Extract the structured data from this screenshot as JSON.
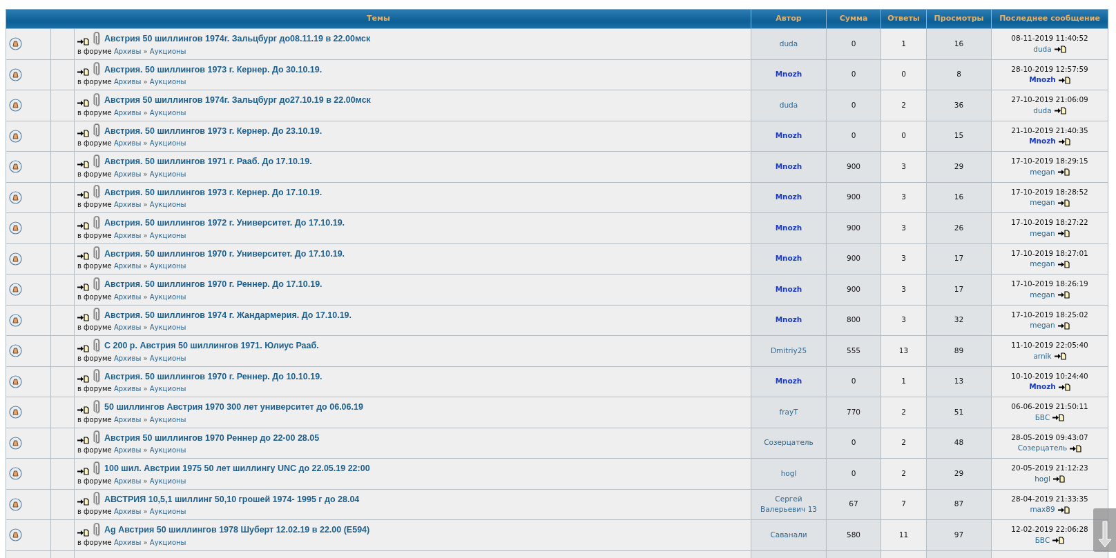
{
  "columns": [
    "Темы",
    "Автор",
    "Сумма",
    "Ответы",
    "Просмотры",
    "Последнее сообщение"
  ],
  "topics": [
    {
      "title": "Австрия 50 шиллингов 1974г. Зальцбург до08.11.19 в 22.00мск",
      "forum_prefix": "в форуме",
      "forum": "Архивы",
      "separator": "»",
      "subforum": "Аукционы",
      "author": {
        "name": "duda",
        "kind": "member"
      },
      "sum": "0",
      "replies": "1",
      "views": "16",
      "last_post": {
        "time": "08-11-2019 11:40:52",
        "author": {
          "name": "duda",
          "kind": "member"
        }
      }
    },
    {
      "title": "Австрия. 50 шиллингов 1973 г. Кернер. До 30.10.19.",
      "forum_prefix": "в форуме",
      "forum": "Архивы",
      "separator": "»",
      "subforum": "Аукционы",
      "author": {
        "name": "Mnozh",
        "kind": "staff"
      },
      "sum": "0",
      "replies": "0",
      "views": "8",
      "last_post": {
        "time": "28-10-2019 12:57:59",
        "author": {
          "name": "Mnozh",
          "kind": "staff"
        }
      }
    },
    {
      "title": "Австрия 50 шиллингов 1974г. Зальцбург до27.10.19 в 22.00мск",
      "forum_prefix": "в форуме",
      "forum": "Архивы",
      "separator": "»",
      "subforum": "Аукционы",
      "author": {
        "name": "duda",
        "kind": "member"
      },
      "sum": "0",
      "replies": "2",
      "views": "36",
      "last_post": {
        "time": "27-10-2019 21:06:09",
        "author": {
          "name": "duda",
          "kind": "member"
        }
      }
    },
    {
      "title": "Австрия. 50 шиллингов 1973 г. Кернер. До 23.10.19.",
      "forum_prefix": "в форуме",
      "forum": "Архивы",
      "separator": "»",
      "subforum": "Аукционы",
      "author": {
        "name": "Mnozh",
        "kind": "staff"
      },
      "sum": "0",
      "replies": "0",
      "views": "15",
      "last_post": {
        "time": "21-10-2019 21:40:35",
        "author": {
          "name": "Mnozh",
          "kind": "staff"
        }
      }
    },
    {
      "title": "Австрия. 50 шиллингов 1971 г. Рааб. До 17.10.19.",
      "forum_prefix": "в форуме",
      "forum": "Архивы",
      "separator": "»",
      "subforum": "Аукционы",
      "author": {
        "name": "Mnozh",
        "kind": "staff"
      },
      "sum": "900",
      "replies": "3",
      "views": "29",
      "last_post": {
        "time": "17-10-2019 18:29:15",
        "author": {
          "name": "megan",
          "kind": "member"
        }
      }
    },
    {
      "title": "Австрия. 50 шиллингов 1973 г. Кернер. До 17.10.19.",
      "forum_prefix": "в форуме",
      "forum": "Архивы",
      "separator": "»",
      "subforum": "Аукционы",
      "author": {
        "name": "Mnozh",
        "kind": "staff"
      },
      "sum": "900",
      "replies": "3",
      "views": "16",
      "last_post": {
        "time": "17-10-2019 18:28:52",
        "author": {
          "name": "megan",
          "kind": "member"
        }
      }
    },
    {
      "title": "Австрия. 50 шиллингов 1972 г. Университет. До 17.10.19.",
      "forum_prefix": "в форуме",
      "forum": "Архивы",
      "separator": "»",
      "subforum": "Аукционы",
      "author": {
        "name": "Mnozh",
        "kind": "staff"
      },
      "sum": "900",
      "replies": "3",
      "views": "26",
      "last_post": {
        "time": "17-10-2019 18:27:22",
        "author": {
          "name": "megan",
          "kind": "member"
        }
      }
    },
    {
      "title": "Австрия. 50 шиллингов 1970 г. Университет. До 17.10.19.",
      "forum_prefix": "в форуме",
      "forum": "Архивы",
      "separator": "»",
      "subforum": "Аукционы",
      "author": {
        "name": "Mnozh",
        "kind": "staff"
      },
      "sum": "900",
      "replies": "3",
      "views": "17",
      "last_post": {
        "time": "17-10-2019 18:27:01",
        "author": {
          "name": "megan",
          "kind": "member"
        }
      }
    },
    {
      "title": "Австрия. 50 шиллингов 1970 г. Реннер. До 17.10.19.",
      "forum_prefix": "в форуме",
      "forum": "Архивы",
      "separator": "»",
      "subforum": "Аукционы",
      "author": {
        "name": "Mnozh",
        "kind": "staff"
      },
      "sum": "900",
      "replies": "3",
      "views": "17",
      "last_post": {
        "time": "17-10-2019 18:26:19",
        "author": {
          "name": "megan",
          "kind": "member"
        }
      }
    },
    {
      "title": "Австрия. 50 шиллингов 1974 г. Жандармерия. До 17.10.19.",
      "forum_prefix": "в форуме",
      "forum": "Архивы",
      "separator": "»",
      "subforum": "Аукционы",
      "author": {
        "name": "Mnozh",
        "kind": "staff"
      },
      "sum": "800",
      "replies": "3",
      "views": "32",
      "last_post": {
        "time": "17-10-2019 18:25:02",
        "author": {
          "name": "megan",
          "kind": "member"
        }
      }
    },
    {
      "title": "С 200 р. Австрия 50 шиллингов 1971. Юлиус Рааб.",
      "forum_prefix": "в форуме",
      "forum": "Архивы",
      "separator": "»",
      "subforum": "Аукционы",
      "author": {
        "name": "Dmitriy25",
        "kind": "member"
      },
      "sum": "555",
      "replies": "13",
      "views": "89",
      "last_post": {
        "time": "11-10-2019 22:05:40",
        "author": {
          "name": "arnik",
          "kind": "member"
        }
      }
    },
    {
      "title": "Австрия. 50 шиллингов 1970 г. Реннер. До 10.10.19.",
      "forum_prefix": "в форуме",
      "forum": "Архивы",
      "separator": "»",
      "subforum": "Аукционы",
      "author": {
        "name": "Mnozh",
        "kind": "staff"
      },
      "sum": "0",
      "replies": "1",
      "views": "13",
      "last_post": {
        "time": "10-10-2019 10:24:40",
        "author": {
          "name": "Mnozh",
          "kind": "staff"
        }
      }
    },
    {
      "title": "50 шиллингов Австрия 1970 300 лет университет до 06.06.19",
      "forum_prefix": "в форуме",
      "forum": "Архивы",
      "separator": "»",
      "subforum": "Аукционы",
      "author": {
        "name": "frayT",
        "kind": "member"
      },
      "sum": "770",
      "replies": "2",
      "views": "51",
      "last_post": {
        "time": "06-06-2019 21:50:11",
        "author": {
          "name": "БВС",
          "kind": "member"
        }
      }
    },
    {
      "title": "Австрия 50 шиллингов 1970 Реннер до 22-00 28.05",
      "forum_prefix": "в форуме",
      "forum": "Архивы",
      "separator": "»",
      "subforum": "Аукционы",
      "author": {
        "name": "Созерцатель",
        "kind": "member"
      },
      "sum": "0",
      "replies": "2",
      "views": "48",
      "last_post": {
        "time": "28-05-2019 09:43:07",
        "author": {
          "name": "Созерцатель",
          "kind": "member"
        }
      }
    },
    {
      "title": "100 шил. Австрии 1975 50 лет шиллингу UNC до 22.05.19 22:00",
      "forum_prefix": "в форуме",
      "forum": "Архивы",
      "separator": "»",
      "subforum": "Аукционы",
      "author": {
        "name": "hogl",
        "kind": "member"
      },
      "sum": "0",
      "replies": "2",
      "views": "29",
      "last_post": {
        "time": "20-05-2019 21:12:23",
        "author": {
          "name": "hogl",
          "kind": "member"
        }
      }
    },
    {
      "title": "АВСТРИЯ 10,5,1 шиллинг 50,10 грошей 1974- 1995 г до 28.04",
      "forum_prefix": "в форуме",
      "forum": "Архивы",
      "separator": "»",
      "subforum": "Аукционы",
      "author": {
        "name": "Сергей Валерьевич 13",
        "kind": "member"
      },
      "sum": "67",
      "replies": "7",
      "views": "87",
      "last_post": {
        "time": "28-04-2019 21:33:35",
        "author": {
          "name": "max89",
          "kind": "member"
        }
      }
    },
    {
      "title": "Ag Австрия 50 шиллингов 1978 Шуберт 12.02.19 в 22.00 (E594)",
      "forum_prefix": "в форуме",
      "forum": "Архивы",
      "separator": "»",
      "subforum": "Аукционы",
      "author": {
        "name": "Саванали",
        "kind": "member"
      },
      "sum": "580",
      "replies": "11",
      "views": "97",
      "last_post": {
        "time": "12-02-2019 22:06:28",
        "author": {
          "name": "БВС",
          "kind": "member"
        }
      }
    }
  ]
}
